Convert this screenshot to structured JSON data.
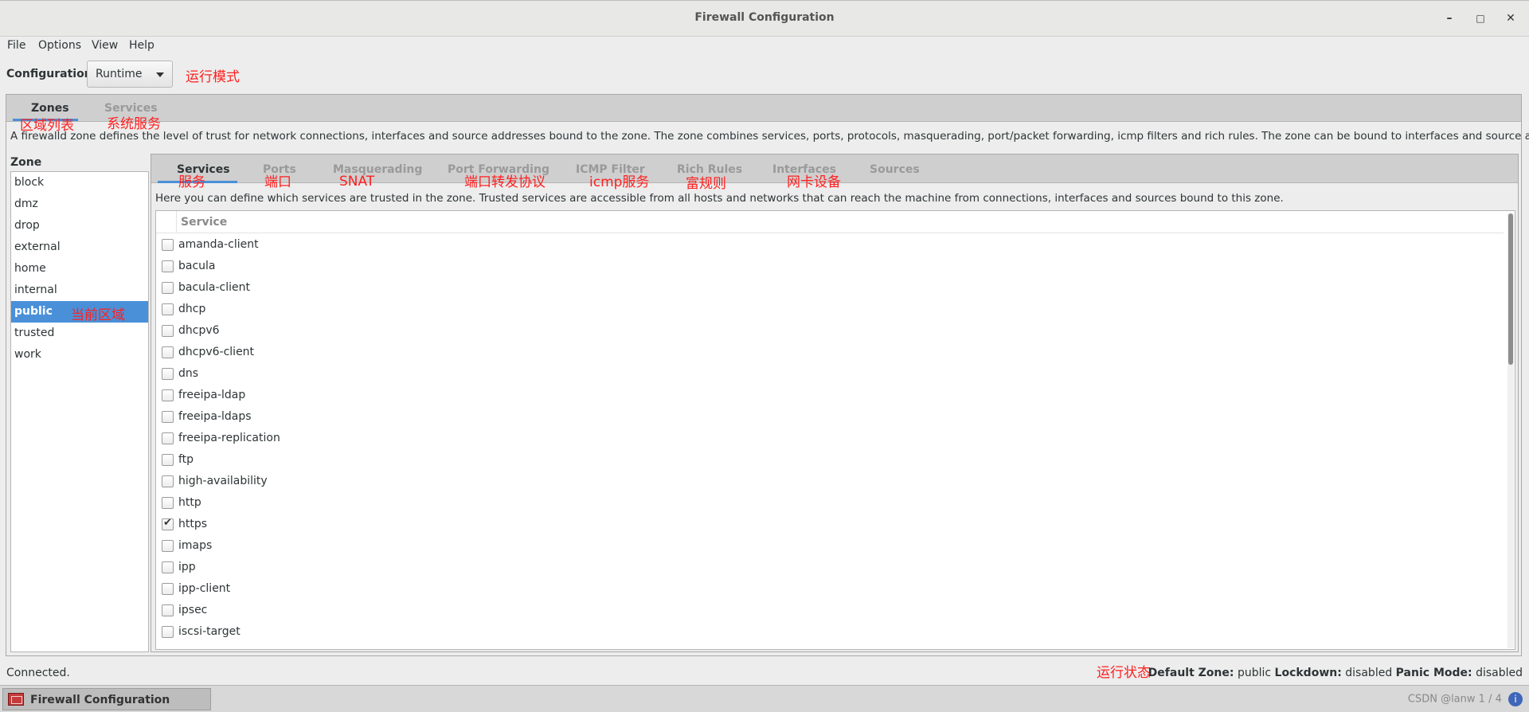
{
  "window": {
    "title": "Firewall Configuration",
    "minimize": "–",
    "maximize": "□",
    "close": "✕"
  },
  "menu": [
    "File",
    "Options",
    "View",
    "Help"
  ],
  "config": {
    "label": "Configuration:",
    "value": "Runtime"
  },
  "top_tabs": [
    {
      "label": "Zones",
      "active": true
    },
    {
      "label": "Services",
      "active": false
    }
  ],
  "zone_description": "A firewalld zone defines the level of trust for network connections, interfaces and source addresses bound to the zone. The zone combines services, ports, protocols, masquerading, port/packet forwarding, icmp filters and rich rules. The zone can be bound to interfaces and source addresses.",
  "zone_header": "Zone",
  "zones": [
    "block",
    "dmz",
    "drop",
    "external",
    "home",
    "internal",
    "public",
    "trusted",
    "work"
  ],
  "selected_zone": "public",
  "inner_tabs": [
    "Services",
    "Ports",
    "Masquerading",
    "Port Forwarding",
    "ICMP Filter",
    "Rich Rules",
    "Interfaces",
    "Sources"
  ],
  "services_description": "Here you can define which services are trusted in the zone. Trusted services are accessible from all hosts and networks that can reach the machine from connections, interfaces and sources bound to this zone.",
  "service_column": "Service",
  "services": [
    {
      "name": "amanda-client",
      "checked": false
    },
    {
      "name": "bacula",
      "checked": false
    },
    {
      "name": "bacula-client",
      "checked": false
    },
    {
      "name": "dhcp",
      "checked": false
    },
    {
      "name": "dhcpv6",
      "checked": false
    },
    {
      "name": "dhcpv6-client",
      "checked": false
    },
    {
      "name": "dns",
      "checked": false
    },
    {
      "name": "freeipa-ldap",
      "checked": false
    },
    {
      "name": "freeipa-ldaps",
      "checked": false
    },
    {
      "name": "freeipa-replication",
      "checked": false
    },
    {
      "name": "ftp",
      "checked": false
    },
    {
      "name": "high-availability",
      "checked": false
    },
    {
      "name": "http",
      "checked": false
    },
    {
      "name": "https",
      "checked": true
    },
    {
      "name": "imaps",
      "checked": false
    },
    {
      "name": "ipp",
      "checked": false
    },
    {
      "name": "ipp-client",
      "checked": false
    },
    {
      "name": "ipsec",
      "checked": false
    },
    {
      "name": "iscsi-target",
      "checked": false
    }
  ],
  "status": {
    "connection": "Connected.",
    "default_zone_label": "Default Zone:",
    "default_zone": "public",
    "lockdown_label": "Lockdown:",
    "lockdown": "disabled",
    "panic_label": "Panic Mode:",
    "panic": "disabled"
  },
  "annotations": {
    "run_mode": "运行模式",
    "zone_list": "区域列表",
    "system_services": "系统服务",
    "current_zone": "当前区域",
    "services": "服务",
    "ports": "端口",
    "snat": "SNAT",
    "port_forwarding": "端口转发协议",
    "icmp": "icmp服务",
    "rich_rules": "富规则",
    "interfaces": "网卡设备",
    "run_status": "运行状态"
  },
  "taskbar": {
    "app": "Firewall Configuration",
    "tray": "CSDN @lanw",
    "page": "1 / 4",
    "info_icon": "i"
  },
  "colors": {
    "accent": "#4a90d9",
    "annotation": "#ff1f1f"
  }
}
